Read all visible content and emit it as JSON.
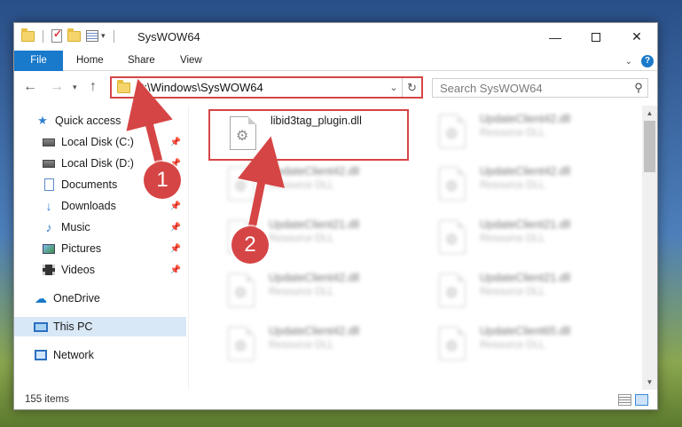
{
  "window": {
    "title": "SysWOW64",
    "controls": {
      "minimize": "—",
      "maximize": "",
      "close": "✕"
    }
  },
  "ribbon": {
    "tabs": [
      "File",
      "Home",
      "Share",
      "View"
    ],
    "help": "?"
  },
  "address_bar": {
    "path": "C:\\Windows\\SysWOW64",
    "refresh": "↻"
  },
  "search": {
    "placeholder": "Search SysWOW64"
  },
  "sidebar": {
    "items": [
      {
        "label": "Quick access",
        "icon": "star-icon",
        "pinned": false
      },
      {
        "label": "Local Disk (C:)",
        "icon": "disk-icon",
        "pinned": true
      },
      {
        "label": "Local Disk (D:)",
        "icon": "disk-icon",
        "pinned": true
      },
      {
        "label": "Documents",
        "icon": "documents-icon",
        "pinned": true
      },
      {
        "label": "Downloads",
        "icon": "download-icon",
        "pinned": true
      },
      {
        "label": "Music",
        "icon": "music-icon",
        "pinned": true
      },
      {
        "label": "Pictures",
        "icon": "pictures-icon",
        "pinned": true
      },
      {
        "label": "Videos",
        "icon": "videos-icon",
        "pinned": true
      },
      {
        "label": "OneDrive",
        "icon": "cloud-icon",
        "pinned": false
      },
      {
        "label": "This PC",
        "icon": "computer-icon",
        "pinned": false,
        "selected": true
      },
      {
        "label": "Network",
        "icon": "network-icon",
        "pinned": false
      }
    ]
  },
  "files": {
    "highlighted": {
      "name": "libid3tag_plugin.dll",
      "type": ""
    },
    "items": [
      {
        "name": "UpdateClient42.dll",
        "type": "Resource DLL"
      },
      {
        "name": "UpdateClient42.dll",
        "type": "Resource DLL"
      },
      {
        "name": "UpdateClient42.dll",
        "type": "Resource DLL"
      },
      {
        "name": "UpdateClient21.dll",
        "type": "Resource DLL"
      },
      {
        "name": "UpdateClient21.dll",
        "type": "Resource DLL"
      },
      {
        "name": "UpdateClient42.dll",
        "type": "Resource DLL"
      },
      {
        "name": "UpdateClient21.dll",
        "type": "Resource DLL"
      },
      {
        "name": "UpdateClient42.dll",
        "type": "Resource DLL"
      },
      {
        "name": "UpdateClient65.dll",
        "type": "Resource DLL"
      }
    ]
  },
  "status": {
    "item_count": "155 items"
  },
  "annotations": {
    "step1": "1",
    "step2": "2",
    "color": "#d64545"
  }
}
